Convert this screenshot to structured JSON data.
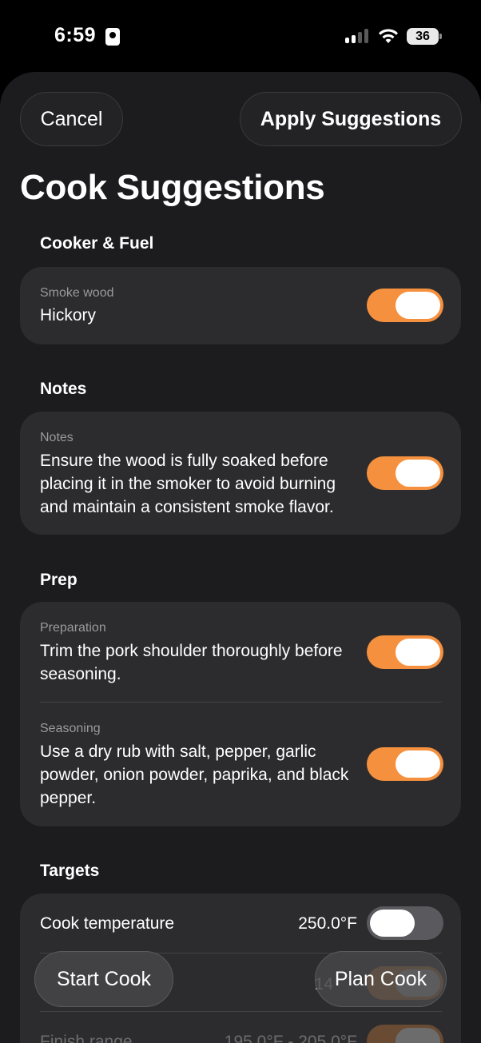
{
  "status": {
    "time": "6:59",
    "battery": "36"
  },
  "header": {
    "cancel_label": "Cancel",
    "apply_label": "Apply Suggestions",
    "title": "Cook Suggestions"
  },
  "sections": {
    "cooker": {
      "title": "Cooker & Fuel",
      "rows": [
        {
          "label": "Smoke wood",
          "value": "Hickory",
          "on": true
        }
      ]
    },
    "notes": {
      "title": "Notes",
      "rows": [
        {
          "label": "Notes",
          "value": "Ensure the wood is fully soaked before placing it in the smoker to avoid burning and maintain a consistent smoke flavor.",
          "on": true
        }
      ]
    },
    "prep": {
      "title": "Prep",
      "rows": [
        {
          "label": "Preparation",
          "value": "Trim the pork shoulder thoroughly before seasoning.",
          "on": true
        },
        {
          "label": "Seasoning",
          "value": "Use a dry rub with salt, pepper, garlic powder, onion powder, paprika, and black pepper.",
          "on": true
        }
      ]
    },
    "targets": {
      "title": "Targets",
      "rows": [
        {
          "label": "Cook temperature",
          "value": "250.0°F",
          "on": false
        },
        {
          "label": "",
          "value": "14",
          "on": true
        },
        {
          "label": "Finish range",
          "value": "195.0°F - 205.0°F",
          "on": true
        }
      ]
    }
  },
  "footer": {
    "start_label": "Start Cook",
    "plan_label": "Plan Cook"
  },
  "colors": {
    "accent": "#f5913e",
    "sheet_bg": "#1c1c1e",
    "card_bg": "#2c2c2e"
  }
}
